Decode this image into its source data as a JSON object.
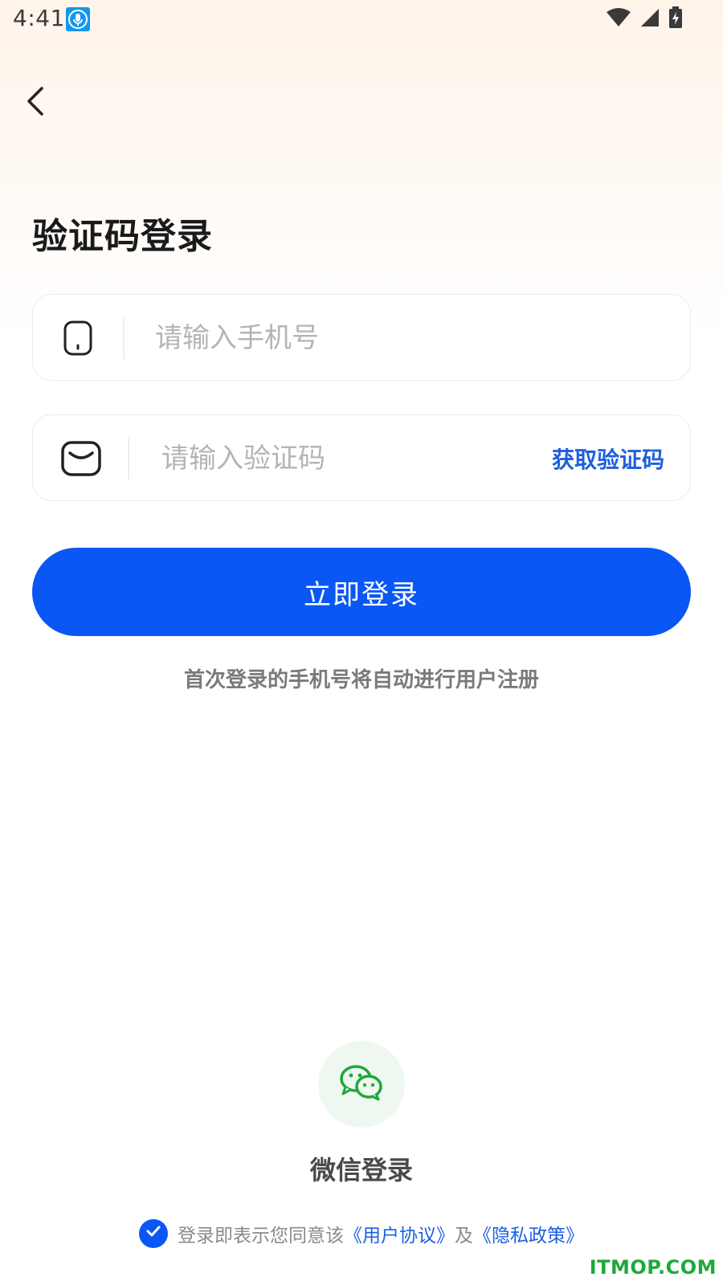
{
  "status_bar": {
    "time": "4:41"
  },
  "icons": {
    "back": "chevron-left-icon",
    "phone": "phone-icon",
    "mail": "mail-icon",
    "wechat": "wechat-icon",
    "check": "check-icon"
  },
  "page": {
    "title": "验证码登录"
  },
  "form": {
    "phone_placeholder": "请输入手机号",
    "phone_value": "",
    "code_placeholder": "请输入验证码",
    "code_value": "",
    "get_code_label": "获取验证码",
    "login_label": "立即登录",
    "hint": "首次登录的手机号将自动进行用户注册"
  },
  "wechat": {
    "label": "微信登录"
  },
  "agreement": {
    "prefix": "登录即表示您同意该",
    "user_agreement": "《用户协议》",
    "conjunction": "及",
    "privacy_policy": "《隐私政策》",
    "checked": true
  },
  "watermark": "ITMOP.COM",
  "colors": {
    "primary": "#0a57f5",
    "link": "#1e5fe0",
    "wechat_green": "#1fa83a"
  }
}
